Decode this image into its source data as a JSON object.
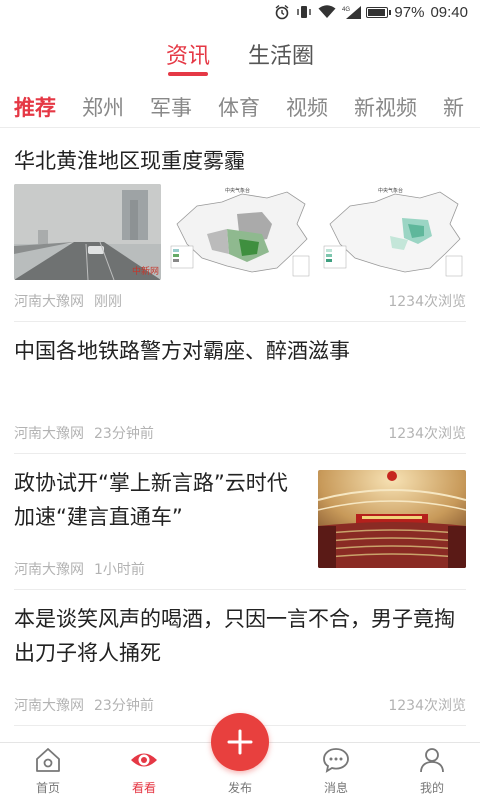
{
  "status_bar": {
    "battery_percent": 97,
    "battery_text": "97%",
    "time": "09:40",
    "network": "4G"
  },
  "top_tabs": [
    {
      "label": "资讯",
      "active": true
    },
    {
      "label": "生活圈",
      "active": false
    }
  ],
  "categories": [
    {
      "label": "推荐",
      "active": true
    },
    {
      "label": "郑州",
      "active": false
    },
    {
      "label": "军事",
      "active": false
    },
    {
      "label": "体育",
      "active": false
    },
    {
      "label": "视频",
      "active": false
    },
    {
      "label": "新视频",
      "active": false
    },
    {
      "label": "新",
      "active": false
    }
  ],
  "feed": [
    {
      "title": "华北黄淮地区现重度雾霾",
      "source": "河南大豫网",
      "time": "刚刚",
      "views": "1234次浏览",
      "thumb_watermark": "中新网",
      "map_title": "中央气象台"
    },
    {
      "title": "中国各地铁路警方对霸座、醉酒滋事",
      "source": "河南大豫网",
      "time": "23分钟前",
      "views": "1234次浏览"
    },
    {
      "title": "政协试开“掌上新言路”云时代加速“建言直通车”",
      "source": "河南大豫网",
      "time": "1小时前"
    },
    {
      "title": "本是谈笑风声的喝酒，只因一言不合，男子竟掏出刀子将人捅死",
      "source": "河南大豫网",
      "time": "23分钟前",
      "views": "1234次浏览"
    }
  ],
  "bottom_nav": [
    {
      "label": "首页",
      "icon": "home-icon",
      "active": false
    },
    {
      "label": "看看",
      "icon": "eye-icon",
      "active": true
    },
    {
      "label": "发布",
      "icon": "plus-icon",
      "active": false
    },
    {
      "label": "消息",
      "icon": "message-icon",
      "active": false
    },
    {
      "label": "我的",
      "icon": "user-icon",
      "active": false
    }
  ],
  "colors": {
    "accent": "#e53845",
    "meta_text": "#b3b3b3",
    "fab": "#e8403e"
  }
}
